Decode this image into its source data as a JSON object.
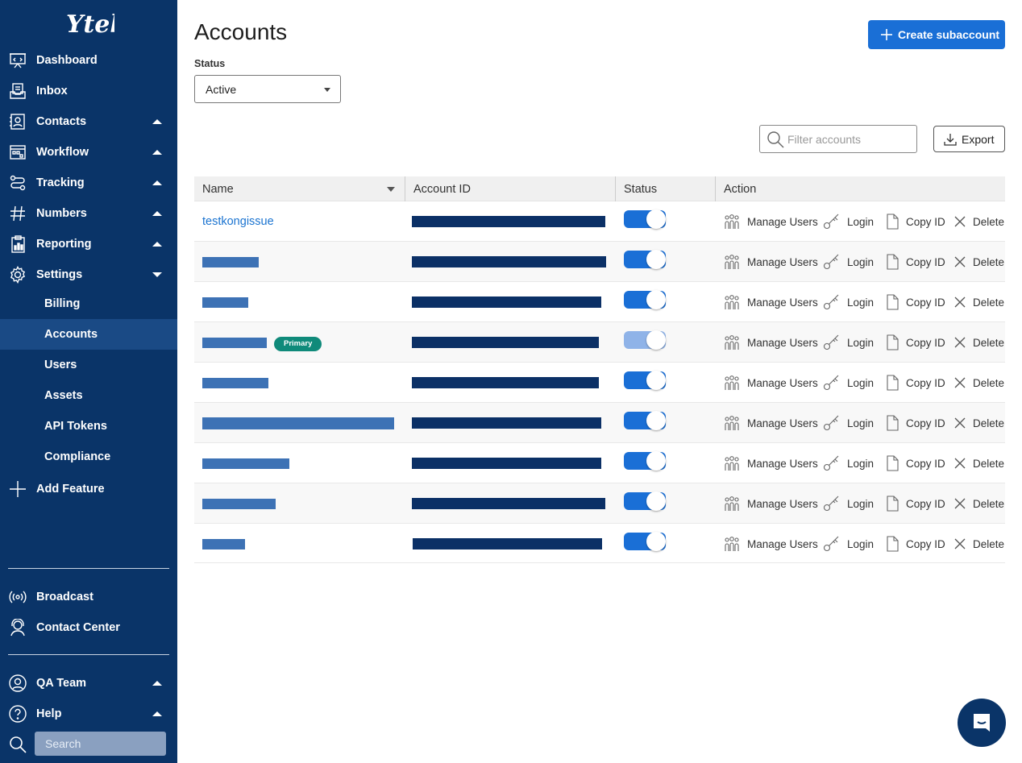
{
  "sidebar": {
    "logo_text": "Ytel",
    "nav": [
      {
        "label": "Dashboard",
        "icon": "dashboard-icon",
        "caret": ""
      },
      {
        "label": "Inbox",
        "icon": "inbox-icon",
        "caret": ""
      },
      {
        "label": "Contacts",
        "icon": "contacts-icon",
        "caret": "up"
      },
      {
        "label": "Workflow",
        "icon": "workflow-icon",
        "caret": "up"
      },
      {
        "label": "Tracking",
        "icon": "tracking-icon",
        "caret": "up"
      },
      {
        "label": "Numbers",
        "icon": "hash-icon",
        "caret": "up"
      },
      {
        "label": "Reporting",
        "icon": "reporting-icon",
        "caret": "up"
      },
      {
        "label": "Settings",
        "icon": "gear-icon",
        "caret": "down"
      }
    ],
    "settings_sub": [
      "Billing",
      "Accounts",
      "Users",
      "Assets",
      "API Tokens",
      "Compliance"
    ],
    "active_sub": "Accounts",
    "add_feature": "Add Feature",
    "bottom": [
      {
        "label": "Broadcast",
        "icon": "broadcast-icon"
      },
      {
        "label": "Contact Center",
        "icon": "headset-icon"
      }
    ],
    "footer": [
      {
        "label": "QA Team",
        "icon": "user-icon",
        "caret": "up"
      },
      {
        "label": "Help",
        "icon": "help-icon",
        "caret": "up"
      }
    ],
    "search_placeholder": "Search"
  },
  "main": {
    "title": "Accounts",
    "create_button": "Create subaccount",
    "status_label": "Status",
    "status_value": "Active",
    "filter_placeholder": "Filter accounts",
    "export_button": "Export"
  },
  "table": {
    "columns": [
      "Name",
      "Account ID",
      "Status",
      "Action"
    ],
    "actions": [
      "Manage Users",
      "Login",
      "Copy ID",
      "Delete"
    ],
    "primary_badge": "Primary",
    "rows": [
      {
        "name": "testkongissue",
        "redacted": false,
        "enabled": true,
        "primary": false
      },
      {
        "name": "",
        "redacted": true,
        "enabled": true,
        "primary": false
      },
      {
        "name": "",
        "redacted": true,
        "enabled": true,
        "primary": false
      },
      {
        "name": "",
        "redacted": true,
        "enabled": true,
        "primary": true,
        "toggle_disabled": true
      },
      {
        "name": "",
        "redacted": true,
        "enabled": true,
        "primary": false
      },
      {
        "name": "",
        "redacted": true,
        "enabled": true,
        "primary": false
      },
      {
        "name": "",
        "redacted": true,
        "enabled": true,
        "primary": false
      },
      {
        "name": "",
        "redacted": true,
        "enabled": true,
        "primary": false
      },
      {
        "name": "",
        "redacted": true,
        "enabled": true,
        "primary": false
      }
    ]
  },
  "colors": {
    "sidebar_bg": "#0a3468",
    "accent": "#1a6fd6",
    "link": "#1a73d0",
    "badge": "#0f8a7a"
  }
}
